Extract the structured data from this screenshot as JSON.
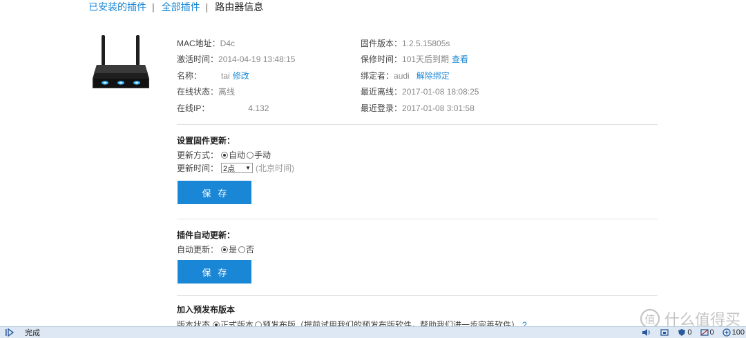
{
  "tabs": {
    "installed": "已安装的插件",
    "separator": "|",
    "all": "全部插件",
    "router_info": "路由器信息"
  },
  "router": {
    "mac_label": "MAC地址：",
    "mac_value": "D4c",
    "activation_label": "激活时间：",
    "activation_value": "2014-04-19 13:48:15",
    "name_label": "名称：",
    "name_value": "tai",
    "name_edit": "修改",
    "online_status_label": "在线状态：",
    "online_status_value": "离线",
    "online_ip_label": "在线IP：",
    "online_ip_value": "4.132",
    "firmware_label": "固件版本：",
    "firmware_value": "1.2.5.15805s",
    "warranty_label": "保修时间：",
    "warranty_value": "101天后到期",
    "warranty_link": "查看",
    "bound_label": "绑定者：",
    "bound_value": "audi",
    "unbind_link": "解除绑定",
    "last_offline_label": "最近离线：",
    "last_offline_value": "2017-01-08 18:08:25",
    "last_login_label": "最近登录：",
    "last_login_value": "2017-01-08 3:01:58"
  },
  "firmware_update": {
    "title": "设置固件更新：",
    "method_label": "更新方式：",
    "option_auto": "自动",
    "option_manual": "手动",
    "time_label": "更新时间：",
    "time_value": "2点",
    "time_hint": "(北京时间)",
    "save": "保存"
  },
  "plugin_update": {
    "title": "插件自动更新：",
    "auto_label": "自动更新：",
    "option_yes": "是",
    "option_no": "否",
    "save": "保存"
  },
  "prerelease": {
    "title": "加入预发布版本",
    "status_label": "版本状态",
    "option_stable": "正式版本",
    "option_pre": "预发布版（提前试用我们的预发布版软件，帮助我们进一步完善软件）",
    "help": "?"
  },
  "statusbar": {
    "text": "完成",
    "shield_count": "0",
    "zoom_count": "0",
    "zoom_level": "100"
  },
  "watermark": {
    "text": "什么值得买"
  }
}
